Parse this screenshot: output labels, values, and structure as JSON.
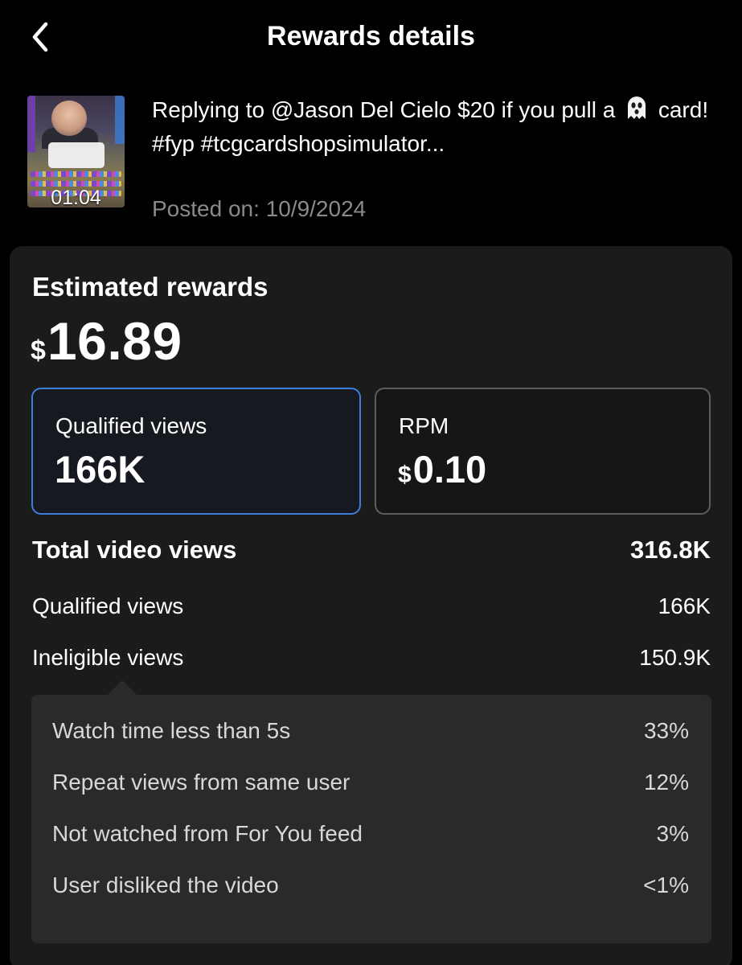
{
  "header": {
    "title": "Rewards details",
    "back_icon": "chevron-left-icon"
  },
  "video": {
    "duration": "01:04",
    "title_before_emoji": "Replying to @Jason Del Cielo $20 if you pull a",
    "title_emoji_icon": "ghost-icon",
    "title_after_emoji": "card! #fyp #tcgcardshopsimulator...",
    "posted_label": "Posted on:",
    "posted_date": "10/9/2024"
  },
  "rewards": {
    "estimated_label": "Estimated rewards",
    "currency_symbol": "$",
    "estimated_value": "16.89"
  },
  "metrics": [
    {
      "label": "Qualified views",
      "value": "166K",
      "currency": "",
      "selected": true
    },
    {
      "label": "RPM",
      "value": "0.10",
      "currency": "$",
      "selected": false
    }
  ],
  "views": {
    "total": {
      "label": "Total video views",
      "value": "316.8K"
    },
    "qualified": {
      "label": "Qualified views",
      "value": "166K"
    },
    "ineligible": {
      "label": "Ineligible views",
      "value": "150.9K"
    }
  },
  "breakdown": [
    {
      "label": "Watch time less than 5s",
      "value": "33%"
    },
    {
      "label": "Repeat views from same user",
      "value": "12%"
    },
    {
      "label": "Not watched from For You feed",
      "value": "3%"
    },
    {
      "label": "User disliked the video",
      "value": "<1%"
    }
  ],
  "colors": {
    "background": "#000000",
    "card": "#1b1b1c",
    "selected_border": "#3e7ddd",
    "muted_text": "#8a8a8a",
    "breakdown_bg": "#2a2a2b"
  }
}
